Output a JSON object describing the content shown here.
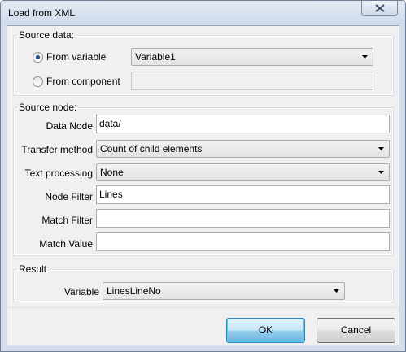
{
  "window": {
    "title": "Load from XML"
  },
  "icons": {
    "close": "close-icon",
    "dropdown": "chevron-down-icon"
  },
  "source_data": {
    "legend": "Source data:",
    "from_variable_label": "From variable",
    "from_variable_selected": true,
    "from_variable_value": "Variable1",
    "from_component_label": "From component",
    "from_component_selected": false,
    "from_component_value": ""
  },
  "source_node": {
    "legend": "Source node:",
    "data_node_label": "Data Node",
    "data_node_value": "data/",
    "transfer_method_label": "Transfer method",
    "transfer_method_value": "Count of child elements",
    "text_processing_label": "Text processing",
    "text_processing_value": "None",
    "node_filter_label": "Node Filter",
    "node_filter_value": "Lines",
    "match_filter_label": "Match Filter",
    "match_filter_value": "",
    "match_value_label": "Match Value",
    "match_value_value": ""
  },
  "result": {
    "legend": "Result",
    "variable_label": "Variable",
    "variable_value": "LinesLineNo"
  },
  "buttons": {
    "ok": "OK",
    "cancel": "Cancel"
  }
}
